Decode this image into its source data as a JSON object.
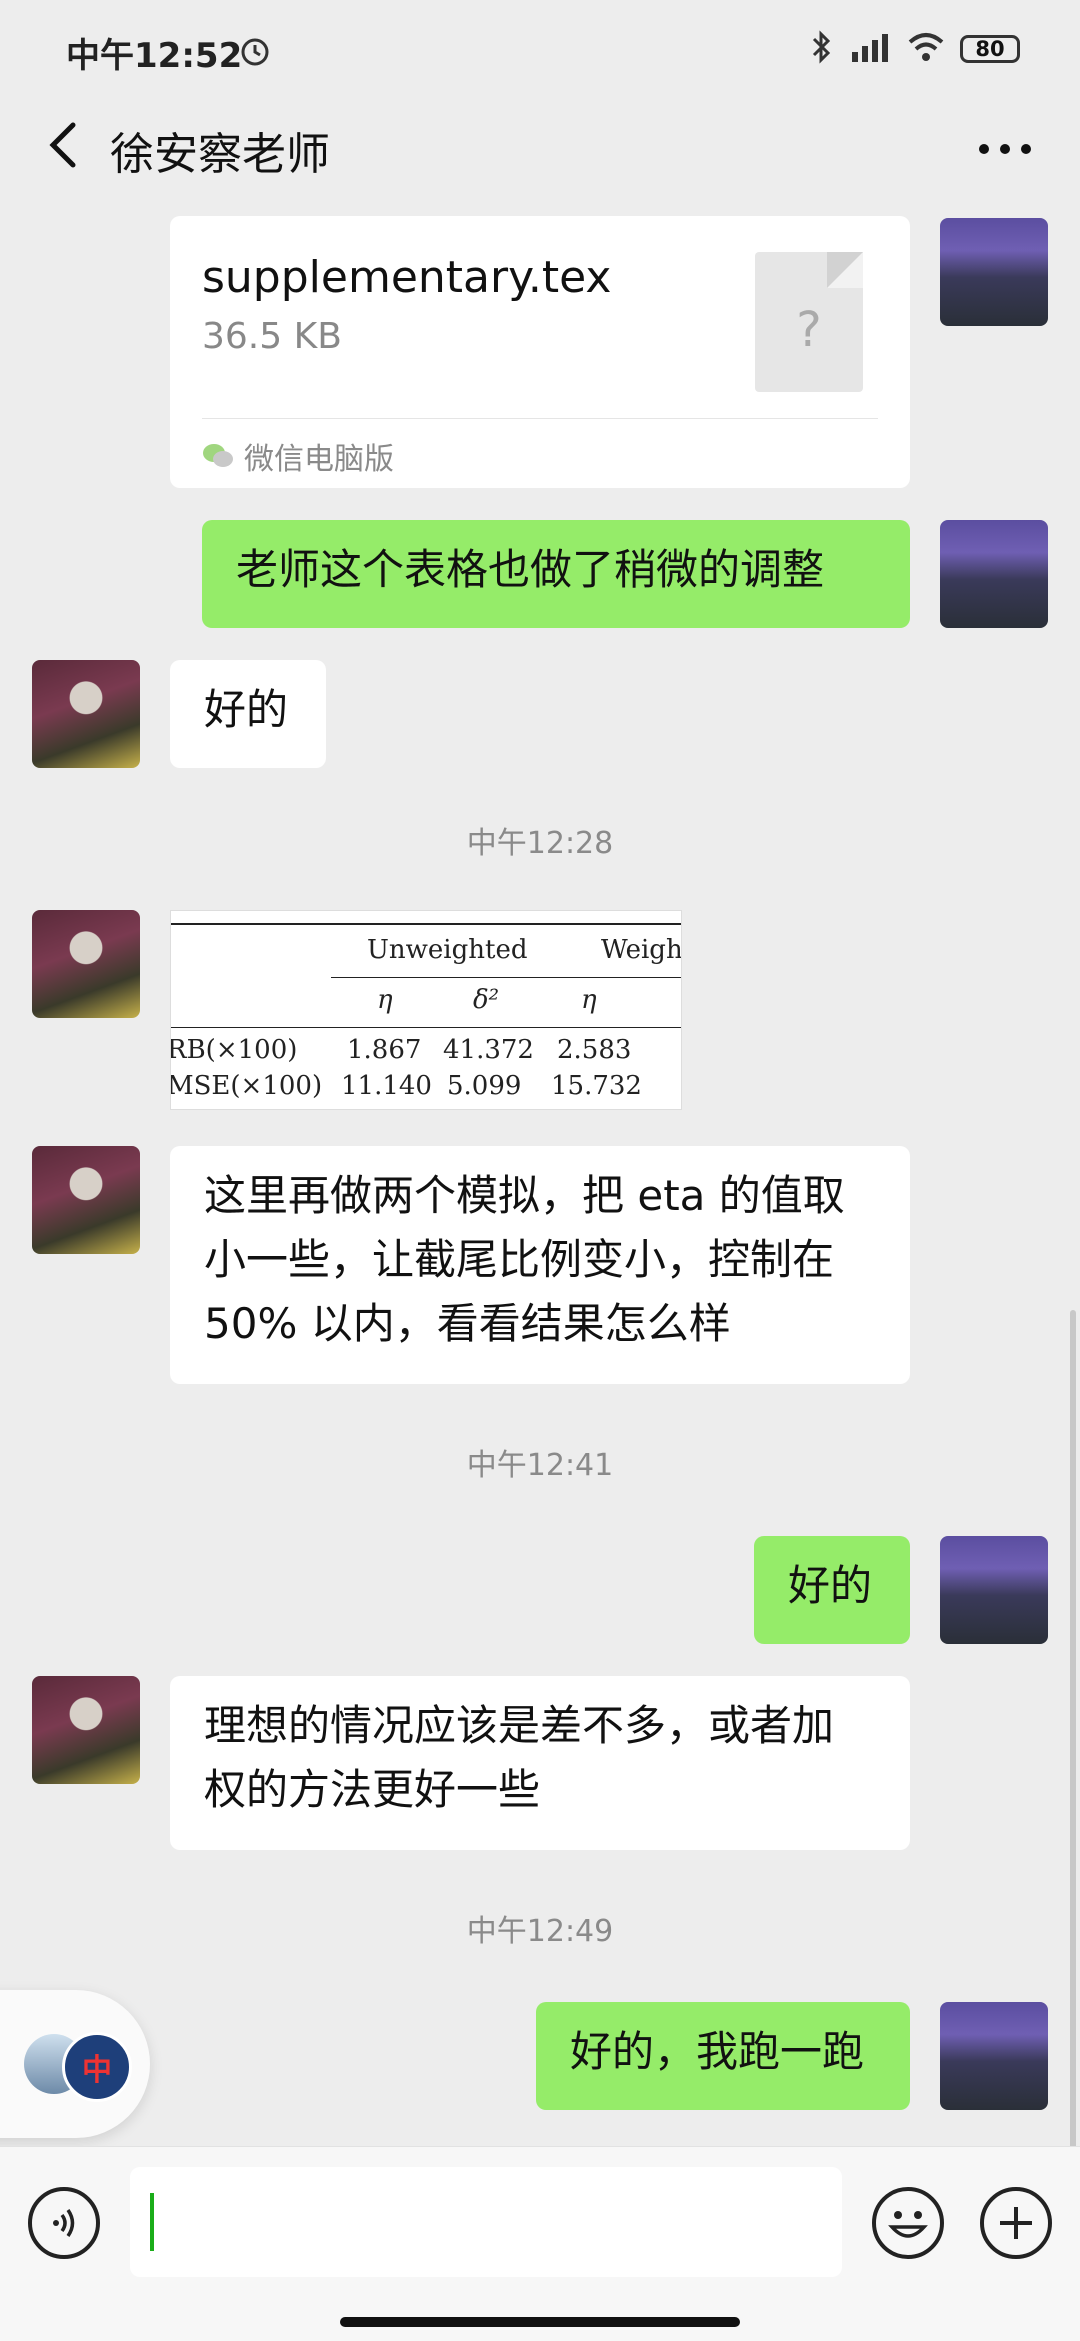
{
  "status_bar": {
    "time": "中午12:52",
    "battery": "80"
  },
  "header": {
    "title": "徐安察老师"
  },
  "file_message": {
    "name": "supplementary.tex",
    "size": "36.5 KB",
    "source": "微信电脑版",
    "icon_glyph": "?"
  },
  "msg_adjust": "老师这个表格也做了稍微的调整",
  "msg_ok1": "好的",
  "ts1": "中午12:28",
  "table_preview": {
    "headers": [
      "Unweighted",
      "Weigh"
    ],
    "sub_headers": [
      "η",
      "δ²",
      "η"
    ],
    "rows": [
      {
        "label": "RB(×100)",
        "cells": [
          "1.867",
          "41.372",
          "2.583"
        ]
      },
      {
        "label": "MSE(×100)",
        "cells": [
          "11.140",
          "5.099",
          "15.732"
        ]
      }
    ]
  },
  "msg_sim_line1": "这里再做两个模拟，把 eta 的值取",
  "msg_sim_line2": "小一些，让截尾比例变小，控制在",
  "msg_sim_line3": "50% 以内，看看结果怎么样",
  "ts2": "中午12:41",
  "msg_ok2": "好的",
  "msg_ideal_line1": "理想的情况应该是差不多，或者加",
  "msg_ideal_line2": "权的方法更好一些",
  "ts3": "中午12:49",
  "msg_run": "好的，我跑一跑",
  "float_badge": "中",
  "colors": {
    "bubble_green": "#95ec69",
    "bubble_white": "#ffffff",
    "background": "#ededed",
    "caret": "#1aad19"
  }
}
